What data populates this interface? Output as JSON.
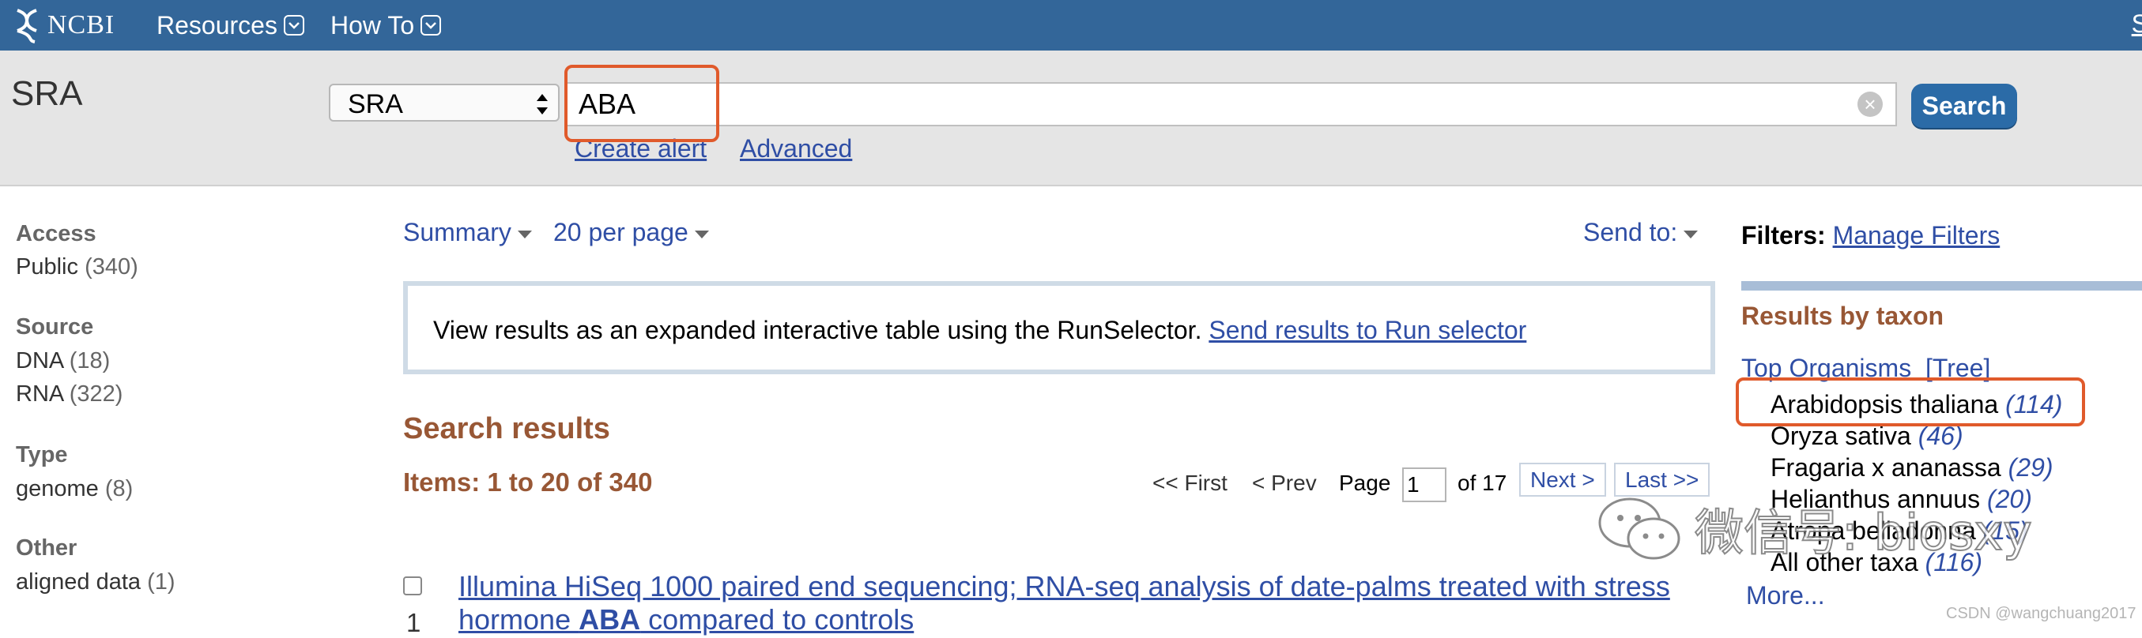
{
  "header": {
    "logo_text": "NCBI",
    "nav": [
      {
        "label": "Resources"
      },
      {
        "label": "How To"
      }
    ],
    "right_link": "S"
  },
  "search": {
    "db_title": "SRA",
    "db_select": "SRA",
    "query": "ABA",
    "button": "Search",
    "create_alert": "Create alert",
    "advanced": "Advanced"
  },
  "facets": [
    {
      "title": "Access",
      "items": [
        {
          "label": "Public",
          "count": "(340)"
        }
      ]
    },
    {
      "title": "Source",
      "items": [
        {
          "label": "DNA",
          "count": "(18)"
        },
        {
          "label": "RNA",
          "count": "(322)"
        }
      ]
    },
    {
      "title": "Type",
      "items": [
        {
          "label": "genome",
          "count": "(8)"
        }
      ]
    },
    {
      "title": "Other",
      "items": [
        {
          "label": "aligned data",
          "count": "(1)"
        }
      ]
    }
  ],
  "controls": {
    "summary": "Summary",
    "per_page": "20 per page",
    "send_to": "Send to:"
  },
  "run_selector": {
    "text": "View results as an expanded interactive table using the RunSelector.",
    "link": "Send results to Run selector"
  },
  "results": {
    "heading": "Search results",
    "items": "Items: 1 to 20 of 340",
    "pager": {
      "first": "<< First",
      "prev": "< Prev",
      "page_label": "Page",
      "page_value": "1",
      "of": "of 17",
      "next": "Next >",
      "last": "Last >>"
    },
    "first": {
      "number": "1",
      "title_line1": "Illumina HiSeq 1000 paired end sequencing; RNA-seq analysis of date-palms treated with stress",
      "title_line2_pre": "hormone ",
      "title_line2_bold": "ABA",
      "title_line2_post": " compared to controls"
    }
  },
  "sidebar": {
    "filters_label": "Filters:",
    "manage_filters": "Manage Filters",
    "results_by_taxon": "Results by taxon",
    "top_organisms": "Top Organisms",
    "tree": "[Tree]",
    "taxa": [
      {
        "name": "Arabidopsis thaliana",
        "count": "(114)"
      },
      {
        "name": "Oryza sativa",
        "count": "(46)"
      },
      {
        "name": "Fragaria x ananassa",
        "count": "(29)"
      },
      {
        "name": "Helianthus annuus",
        "count": "(20)"
      },
      {
        "name": "Atropa belladonna",
        "count": "(15)"
      },
      {
        "name": "All other taxa",
        "count": "(116)"
      }
    ],
    "more": "More..."
  },
  "watermark": {
    "text": "微信号: biosxy",
    "csdn": "CSDN @wangchuang2017"
  },
  "colors": {
    "header_bg": "#336699",
    "link": "#2f4ea5",
    "heading_brown": "#985735",
    "highlight": "#e05a2b"
  }
}
